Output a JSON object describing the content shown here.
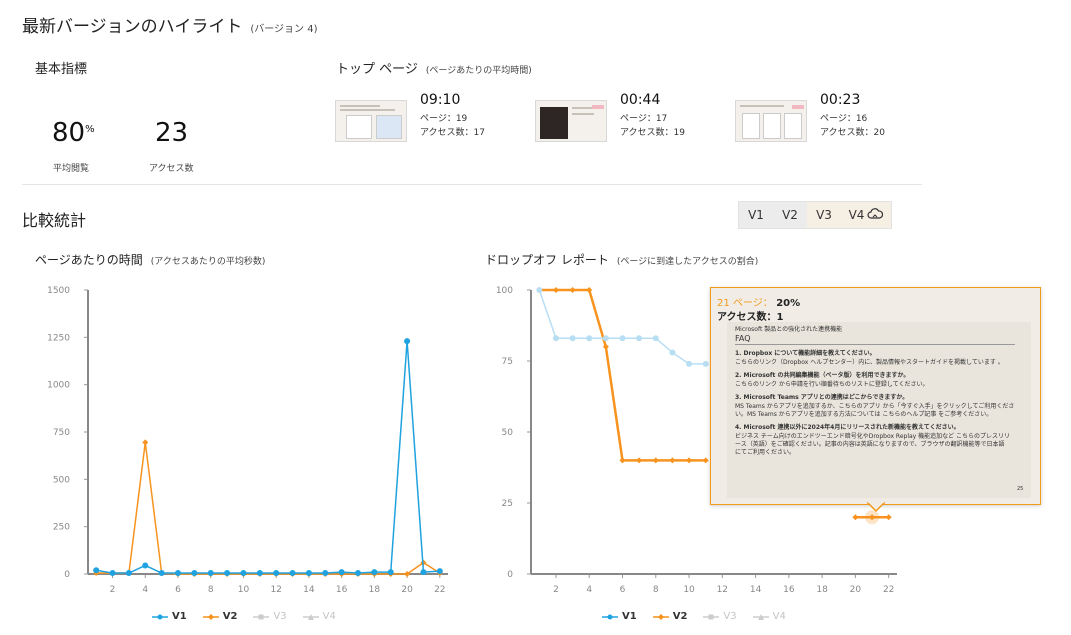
{
  "header": {
    "title": "最新バージョンのハイライト",
    "version": "(バージョン 4)"
  },
  "basic": {
    "title": "基本指標",
    "avg_view_value": "80",
    "avg_view_unit": "%",
    "avg_view_label": "平均閲覧",
    "access_value": "23",
    "access_label": "アクセス数"
  },
  "top_pages": {
    "title": "トップ ページ",
    "subtitle": "(ページあたりの平均時間)",
    "cards": [
      {
        "time": "09:10",
        "page": "ページ：19",
        "access": "アクセス数：17"
      },
      {
        "time": "00:44",
        "page": "ページ：17",
        "access": "アクセス数：19"
      },
      {
        "time": "00:23",
        "page": "ページ：16",
        "access": "アクセス数：20"
      }
    ]
  },
  "compare": {
    "title": "比較統計",
    "tabs": [
      "V1",
      "V2",
      "V3",
      "V4"
    ]
  },
  "colors": {
    "v1": "#1fa2e0",
    "v1_light": "#b8def4",
    "v2": "#f7931e",
    "off": "#cccccc",
    "axis": "#888888",
    "tooltip_border": "#f19a1c"
  },
  "time_chart": {
    "title": "ページあたりの時間",
    "subtitle": "(アクセスあたりの平均秒数)"
  },
  "drop_chart": {
    "title": "ドロップオフ レポート",
    "subtitle": "(ページに到達したアクセスの割合)"
  },
  "legend": [
    "V1",
    "V2",
    "V3",
    "V4"
  ],
  "tooltip": {
    "page": "21 ページ：",
    "pct": "20%",
    "access": "アクセス数：1",
    "doc_title": "Microsoft 製品との強化された連携機能",
    "doc_heading": "FAQ",
    "doc_lines": [
      "1.  Dropbox について機能詳細を教えてください。",
      "こちらのリンク（Dropbox ヘルプセンター）内に、製品情報やスタートガイドを掲載しています 。",
      "2.  Microsoft の共同編集機能（ベータ版）を利用できますか。",
      "こちらのリンク から申請を行い順番待ちのリストに登録してください。",
      "3.  Microsoft Teams アプリとの連携はどこからできますか。",
      "MS Teams からアプリを追加するか、こちらのアプリ から「今すぐ入手」をクリックしてご利用くださ",
      "い。MS Teams からアプリを追加する方法については こちらのヘルプ記事 をご参考ください。",
      "4.  Microsoft 連携以外に2024年4月にリリースされた新機能を教えてください。",
      "ビジネス チーム向けのエンドツーエンド暗号化やDropbox Replay 機能追加など こちらのプレスリリ",
      "ース（英語）をご確認ください。記事の内容は英語になりますので、ブラウザの翻訳機能等で日本語",
      "にてご利用ください。"
    ],
    "doc_page": "25"
  },
  "chart_data": [
    {
      "type": "line",
      "title": "ページあたりの時間",
      "subtitle": "(アクセスあたりの平均秒数)",
      "x": [
        1,
        2,
        3,
        4,
        5,
        6,
        7,
        8,
        9,
        10,
        11,
        12,
        13,
        14,
        15,
        16,
        17,
        18,
        19,
        20,
        21,
        22
      ],
      "x_ticks": [
        2,
        4,
        6,
        8,
        10,
        12,
        14,
        16,
        18,
        20,
        22
      ],
      "ylim": [
        0,
        1500
      ],
      "y_ticks": [
        0,
        250,
        500,
        750,
        1000,
        1250,
        1500
      ],
      "series": [
        {
          "name": "V1",
          "values": [
            20,
            5,
            5,
            45,
            5,
            5,
            5,
            5,
            5,
            5,
            5,
            5,
            5,
            5,
            5,
            10,
            5,
            10,
            10,
            1230,
            10,
            15
          ]
        },
        {
          "name": "V2",
          "values": [
            5,
            5,
            5,
            695,
            5,
            0,
            0,
            0,
            0,
            0,
            0,
            0,
            0,
            0,
            0,
            0,
            0,
            0,
            0,
            0,
            60,
            5
          ]
        },
        {
          "name": "V3",
          "values": []
        },
        {
          "name": "V4",
          "values": []
        }
      ]
    },
    {
      "type": "line",
      "title": "ドロップオフ レポート",
      "subtitle": "(ページに到達したアクセスの割合)",
      "x": [
        1,
        2,
        3,
        4,
        5,
        6,
        7,
        8,
        9,
        10,
        11,
        12,
        13,
        14,
        15,
        16,
        17,
        18,
        19,
        20,
        21,
        22
      ],
      "x_ticks": [
        2,
        4,
        6,
        8,
        10,
        12,
        14,
        16,
        18,
        20,
        22
      ],
      "ylim": [
        0,
        100
      ],
      "y_ticks": [
        0,
        25,
        50,
        75,
        100
      ],
      "series": [
        {
          "name": "V1",
          "values": [
            100,
            83,
            83,
            83,
            83,
            83,
            83,
            83,
            78,
            74,
            74
          ]
        },
        {
          "name": "V2",
          "values": [
            100,
            100,
            100,
            100,
            80,
            40,
            40,
            40,
            40,
            40,
            40,
            null,
            null,
            null,
            null,
            null,
            null,
            null,
            null,
            20,
            20,
            20
          ]
        },
        {
          "name": "V3",
          "values": []
        },
        {
          "name": "V4",
          "values": []
        }
      ]
    }
  ]
}
